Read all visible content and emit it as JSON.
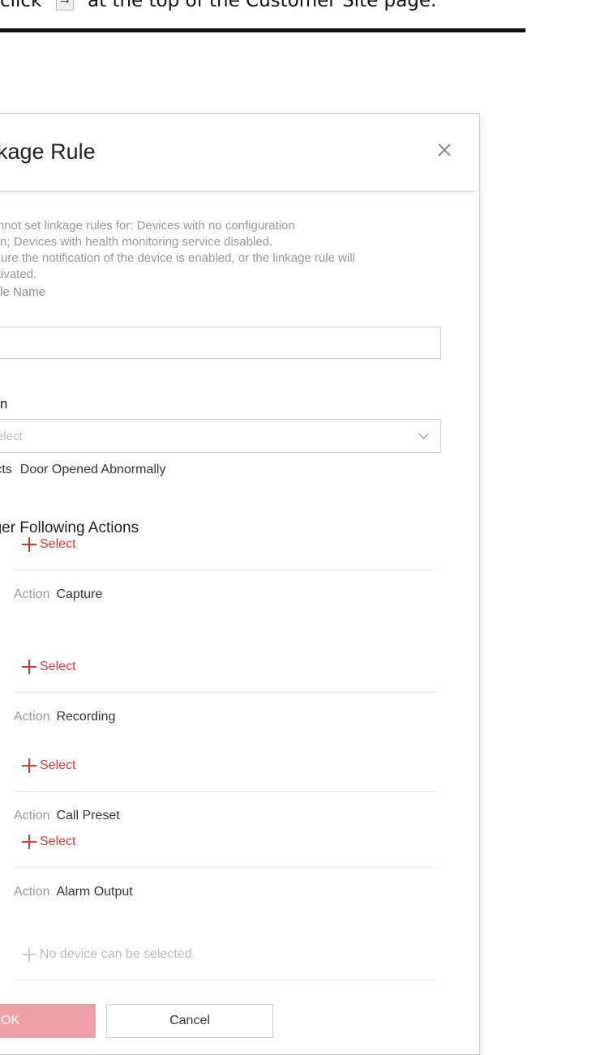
{
  "doc": {
    "instruction_prefix": "click",
    "instruction_icon": "arrow-right-icon",
    "instruction_suffix": "at the top of the Customer Site page."
  },
  "dialog": {
    "title": "nkage Rule",
    "close_icon": "close-icon",
    "note_lines": [
      "cannot set linkage rules for: Devices with no configuration",
      "sion; Devices with health monitoring service disabled.",
      "e sure the notification of the device is enabled, or the linkage rule will",
      "activated."
    ],
    "rule_name_label": "Rule Name",
    "rule_name_value": "",
    "when_label": "hen",
    "when_placeholder": "elect",
    "detects_label": "tects",
    "detects_value": "Door Opened Abnormally",
    "trigger_label": "gger Following Actions",
    "actions": [
      {
        "select_label": "Select",
        "action_key": "Action",
        "action_value": "Capture",
        "enabled": true
      },
      {
        "select_label": "Select",
        "action_key": "Action",
        "action_value": "Recording",
        "enabled": true
      },
      {
        "select_label": "Select",
        "action_key": "Action",
        "action_value": "Call Preset",
        "enabled": true
      },
      {
        "select_label": "Select",
        "action_key": "Action",
        "action_value": "Alarm Output",
        "enabled": true
      }
    ],
    "no_device_label": "No device can be selected.",
    "ok_label": "OK",
    "cancel_label": "Cancel"
  },
  "colors": {
    "accent": "#d9363e",
    "ok_disabled": "#eea0a4"
  }
}
